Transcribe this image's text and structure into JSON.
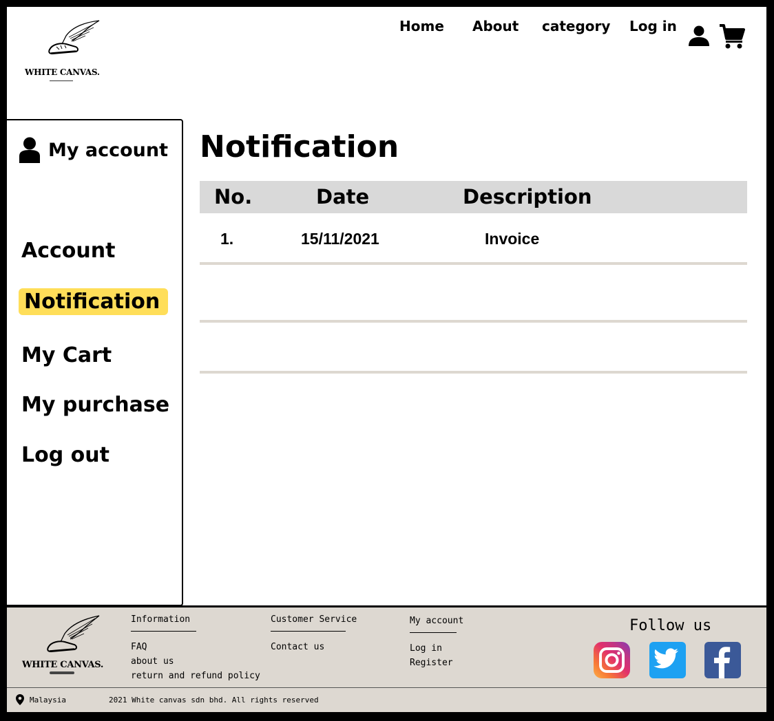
{
  "brand": {
    "name": "WHITE CANVAS."
  },
  "nav": {
    "home": "Home",
    "about": "About",
    "category": "category",
    "login": "Log in",
    "user_icon": "user-icon",
    "cart_icon": "cart-icon"
  },
  "sidebar": {
    "header": "My account",
    "items": [
      {
        "label": "Account",
        "active": false
      },
      {
        "label": "Notification",
        "active": true
      },
      {
        "label": "My Cart",
        "active": false
      },
      {
        "label": "My purchase",
        "active": false
      },
      {
        "label": "Log out",
        "active": false
      }
    ],
    "highlight_color": "#ffde59"
  },
  "main": {
    "title": "Notification",
    "table": {
      "headers": {
        "no": "No.",
        "date": "Date",
        "description": "Description"
      },
      "rows": [
        {
          "no": "1.",
          "date": "15/11/2021",
          "description": "Invoice"
        }
      ]
    }
  },
  "footer": {
    "brand": "WHITE CANVAS.",
    "information": {
      "title": "Information",
      "links": [
        "FAQ",
        "about us",
        "return and refund policy"
      ]
    },
    "customer_service": {
      "title": "Customer Service",
      "links": [
        "Contact us"
      ]
    },
    "my_account": {
      "title": "My account",
      "links": [
        "Log in",
        "Register"
      ]
    },
    "follow": {
      "label": "Follow us",
      "icons": [
        "instagram-icon",
        "twitter-icon",
        "facebook-icon"
      ]
    },
    "location": "Malaysia",
    "copyright": "2021 White canvas sdn bhd. All rights reserved",
    "background": "#ddd8d1"
  }
}
